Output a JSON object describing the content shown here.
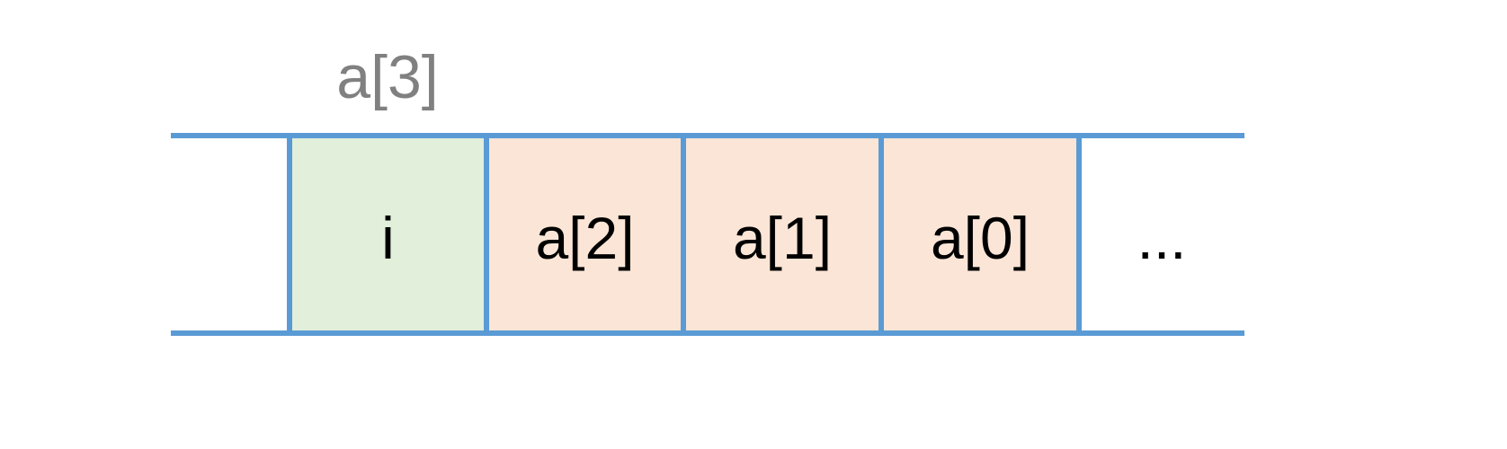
{
  "colors": {
    "line": "#5b9bd5",
    "fill_variable": "#e2efda",
    "fill_array": "#fbe5d6",
    "fill_empty": "#ffffff",
    "text": "#000000",
    "label_text": "#808080"
  },
  "above_label": "a[3]",
  "cells": [
    {
      "text": "",
      "fill": "empty"
    },
    {
      "text": "i",
      "fill": "variable"
    },
    {
      "text": "a[2]",
      "fill": "array"
    },
    {
      "text": "a[1]",
      "fill": "array"
    },
    {
      "text": "a[0]",
      "fill": "array"
    },
    {
      "text": "...",
      "fill": "empty"
    }
  ]
}
